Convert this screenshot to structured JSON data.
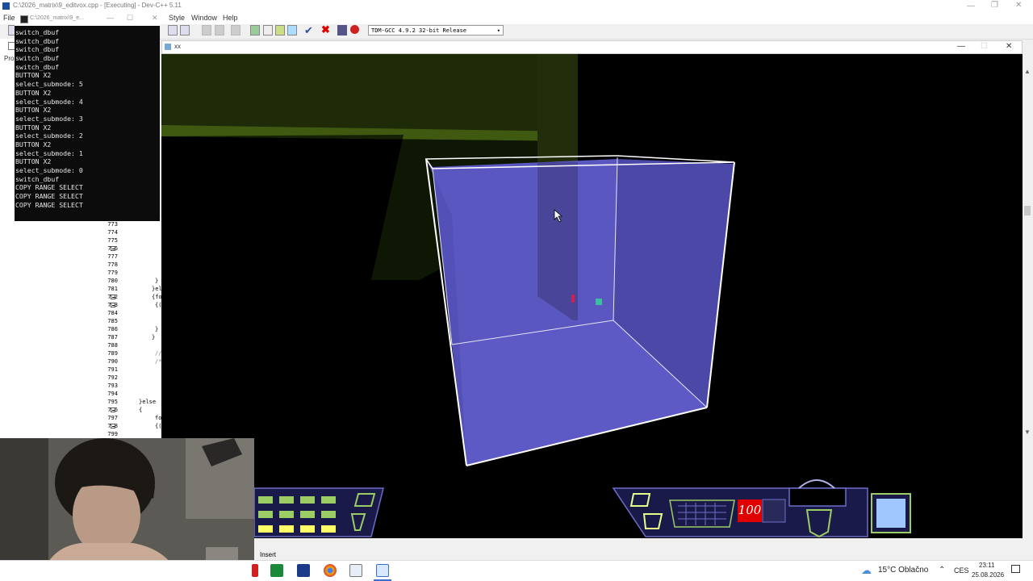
{
  "ide": {
    "window_title": "C:\\2026_matrix\\9_editvox.cpp - [Executing] - Dev-C++ 5.11",
    "menu": [
      "File",
      "Style",
      "Window",
      "Help"
    ],
    "project_tab_label": "Pro",
    "compiler": "TDM-GCC 4.9.2 32-bit Release",
    "line_numbers": [
      "773",
      "774",
      "775",
      "776",
      "777",
      "778",
      "779",
      "780",
      "781",
      "782",
      "783",
      "784",
      "785",
      "786",
      "787",
      "788",
      "789",
      "790",
      "791",
      "792",
      "793",
      "794",
      "795",
      "796",
      "797",
      "798",
      "799"
    ],
    "code_fragments": {
      "l780": "}",
      "l781": "}el",
      "l782": "{fo",
      "l783": "{(c",
      "l786": "}",
      "l787": "}",
      "l789": "//",
      "l790": "/*",
      "l795": "}else",
      "l796": "{",
      "l797": "fo",
      "l798": "{(c"
    },
    "status_mode": "Insert"
  },
  "console": {
    "title": "C:\\2026_matrix\\9_e...",
    "lines": [
      "switch_dbuf",
      "switch_dbuf",
      "switch_dbuf",
      "switch_dbuf",
      "switch_dbuf",
      "BUTTON X2",
      "select_submode: 5",
      "BUTTON X2",
      "select_submode: 4",
      "BUTTON X2",
      "select_submode: 3",
      "BUTTON X2",
      "select_submode: 2",
      "BUTTON X2",
      "select_submode: 1",
      "BUTTON X2",
      "select_submode: 0",
      "switch_dbuf",
      "COPY RANGE SELECT",
      "COPY RANGE SELECT",
      "COPY RANGE SELECT"
    ]
  },
  "game": {
    "window_title": "xx",
    "hud_counter": "100"
  },
  "taskbar": {
    "weather": "15°C Oblačno",
    "language": "CES",
    "time": "23:11",
    "date": "25.08.2026"
  },
  "colors": {
    "cube_face": "#5a57c0",
    "cube_edge": "#ffffff",
    "hud_green": "#9ccc64",
    "hud_yellow": "#ffff66",
    "hud_counter_bg": "#e00000"
  },
  "icons": {
    "close": "close-icon",
    "minimize": "minimize-icon",
    "maximize": "maximize-icon",
    "chevron": "chevron-down-icon",
    "weather": "cloud-icon",
    "notifications": "notification-icon"
  }
}
